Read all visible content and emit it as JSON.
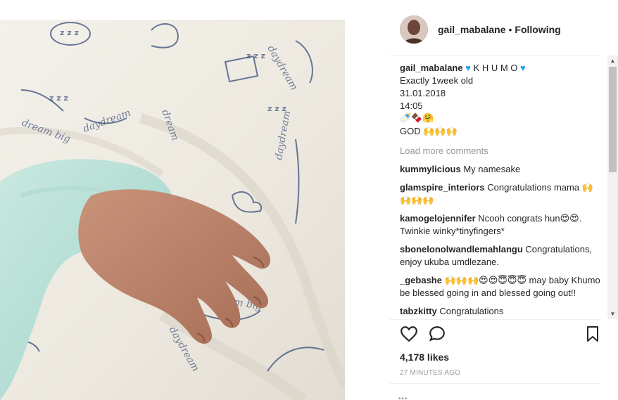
{
  "post": {
    "username": "gail_mabalane",
    "separator": "•",
    "follow_state": "Following",
    "caption": {
      "username": "gail_mabalane",
      "lines": [
        "K H U M O",
        "Exactly 1week old",
        "31.01.2018",
        "14:05",
        "🍼🍫🤗",
        "GOD 🙌🙌🙌"
      ]
    },
    "load_more": "Load more comments",
    "comments": [
      {
        "user": "kummylicious",
        "text": "My namesake"
      },
      {
        "user": "glamspire_interiors",
        "text": "Congratulations mama 🙌🙌🙌🙌"
      },
      {
        "user": "kamogelojennifer",
        "text": "Ncooh congrats hun😍😍. Twinkie winky*tinyfingers*"
      },
      {
        "user": "sbonelonolwandlemahlangu",
        "text": "Congratulations, enjoy ukuba umdlezane."
      },
      {
        "user": "_gebashe",
        "text": "🙌🙌🙌😍😍😇😇😇 may baby Khumo be blessed going in and blessed going out!!"
      },
      {
        "user": "tabzkitty",
        "text": "Congratulations"
      }
    ],
    "likes": "4,178 likes",
    "time": "27 MINUTES AGO",
    "more": "•••"
  },
  "icons": {
    "like": "heart-outline-icon",
    "comment": "comment-bubble-icon",
    "save": "bookmark-icon"
  },
  "colors": {
    "heart_blue": "#1da1f2",
    "muted": "#999999",
    "text": "#262626"
  }
}
